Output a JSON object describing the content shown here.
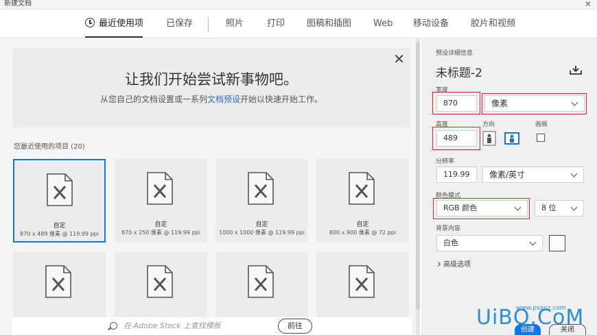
{
  "window": {
    "title": "新建文档",
    "close_glyph": "✕"
  },
  "tabs": [
    {
      "label": "最近使用项",
      "active": true
    },
    {
      "label": "已保存"
    },
    {
      "label": "照片"
    },
    {
      "label": "打印"
    },
    {
      "label": "图稿和插图"
    },
    {
      "label": "Web"
    },
    {
      "label": "移动设备"
    },
    {
      "label": "胶片和视频"
    }
  ],
  "welcome": {
    "headline": "让我们开始尝试新事物吧。",
    "sub_before": "从您自己的文档设置或一系列",
    "sub_link": "文档预设",
    "sub_after": "开始以快速开始工作。",
    "dismiss": "✕"
  },
  "recent": {
    "label": "您最近使用的项目 (20)",
    "items": [
      {
        "name": "自定",
        "spec": "870 x 489 像素 @ 119.99 ppi",
        "selected": true
      },
      {
        "name": "自定",
        "spec": "870 x 250 像素 @ 119.99 ppi"
      },
      {
        "name": "自定",
        "spec": "1000 x 1000 像素 @ 119.99 ppi"
      },
      {
        "name": "自定",
        "spec": "600 x 900 像素 @ 72 ppi"
      }
    ]
  },
  "stock": {
    "placeholder": "在 Adobe Stock 上查找模板",
    "go_label": "前往"
  },
  "details": {
    "section_label": "预设详细信息",
    "doc_title": "未标题-2",
    "width_label": "宽度",
    "width_value": "870",
    "width_unit": "像素",
    "height_label": "高度",
    "height_value": "489",
    "orientation_label": "方向",
    "artboard_label": "画板",
    "resolution_label": "分辨率",
    "resolution_value": "119.99",
    "resolution_unit": "像素/英寸",
    "color_mode_label": "颜色模式",
    "color_mode_value": "RGB 颜色",
    "bit_depth": "8 位",
    "background_label": "背景内容",
    "background_value": "白色",
    "advanced_label": "高级选项",
    "create_label": "创建",
    "close_label": "关闭"
  },
  "watermark": {
    "brand": "UiBQ.CoM",
    "url": "www.psanz.com"
  },
  "colors": {
    "accent": "#1473e6",
    "highlight": "#d9262c",
    "link": "#2b6cc4"
  }
}
